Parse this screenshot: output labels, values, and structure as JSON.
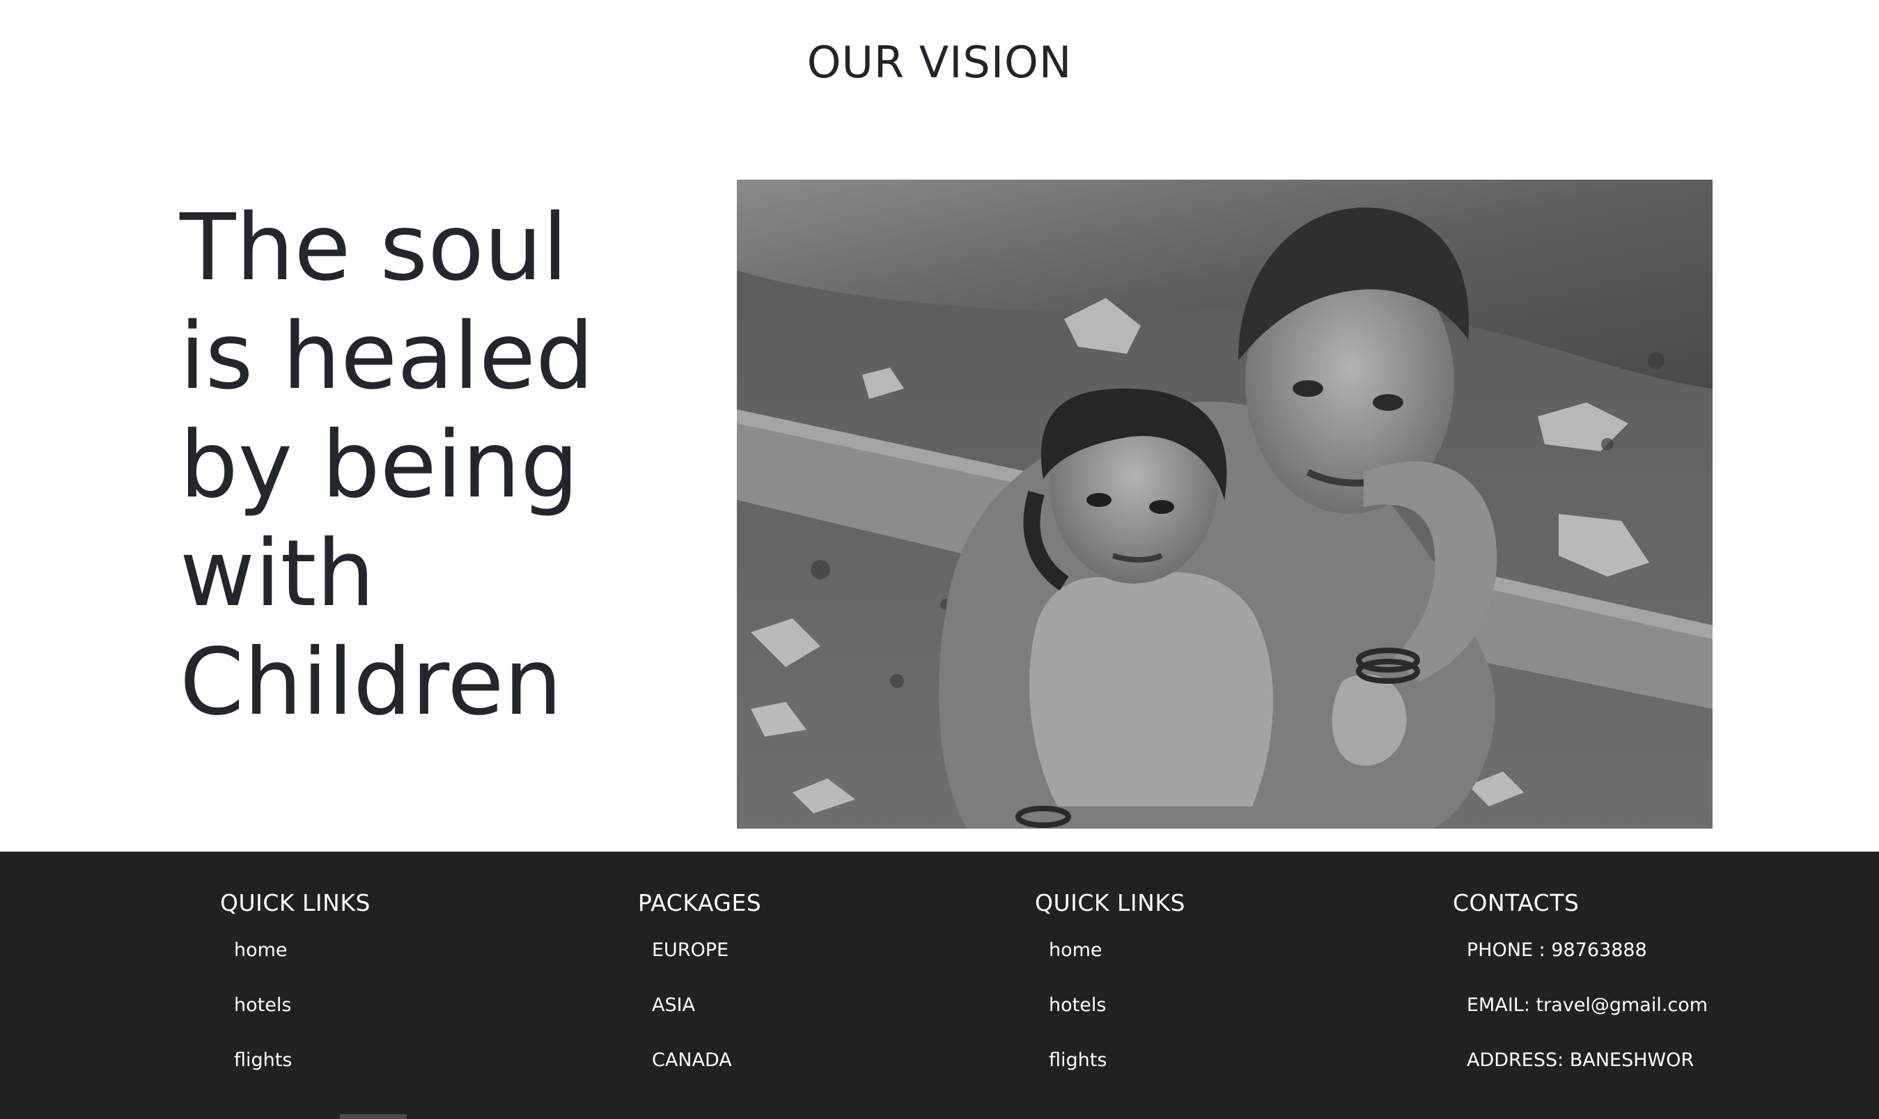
{
  "vision": {
    "title": "OUR VISION",
    "quote_lines": [
      "The soul",
      "is healed",
      "by being",
      "with",
      "Children"
    ],
    "image_alt": "black-and-white photo of two children"
  },
  "footer": {
    "columns": [
      {
        "heading": "QUICK LINKS",
        "items": [
          "home",
          "hotels",
          "flights"
        ]
      },
      {
        "heading": "PACKAGES",
        "items": [
          "EUROPE",
          "ASIA",
          "CANADA"
        ]
      },
      {
        "heading": "QUICK LINKS",
        "items": [
          "home",
          "hotels",
          "flights"
        ]
      },
      {
        "heading": "CONTACTS",
        "items": [
          "PHONE : 98763888",
          "EMAIL: travel@gmail.com",
          "ADDRESS: BANESHWOR"
        ]
      }
    ]
  },
  "colors": {
    "text_dark": "#212529",
    "footer_bg": "#212121",
    "footer_text": "#ffffff"
  }
}
